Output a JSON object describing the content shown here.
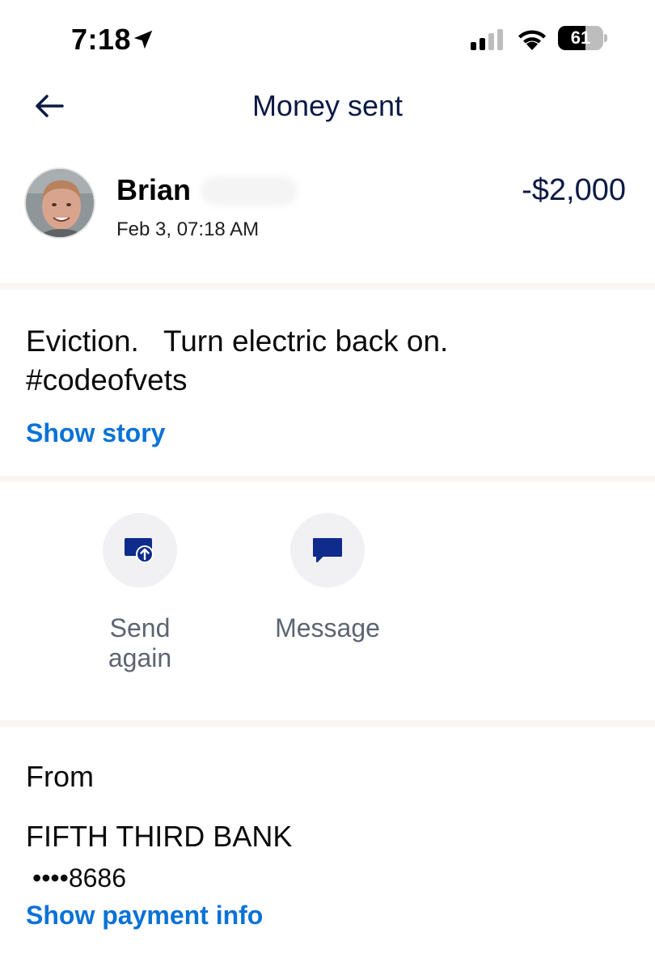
{
  "status_bar": {
    "time": "7:18",
    "battery_level": "61",
    "battery_fraction": 0.61
  },
  "header": {
    "title": "Money sent",
    "back_icon": "arrow-left-icon"
  },
  "transaction": {
    "recipient_name": "Brian",
    "date": "Feb 3, 07:18 AM",
    "amount": "-$2,000"
  },
  "note": {
    "text": "Eviction.   Turn electric back on.\n#codeofvets",
    "show_story_label": "Show story"
  },
  "actions": [
    {
      "label": "Send again",
      "icon": "send-again-icon"
    },
    {
      "label": "Message",
      "icon": "message-icon"
    }
  ],
  "funding": {
    "from_label": "From",
    "bank_name": "FIFTH THIRD BANK",
    "account_masked": "••••8686",
    "show_payment_label": "Show payment info"
  },
  "colors": {
    "link": "#0a72d8",
    "title": "#0c1a46",
    "icon_blue": "#0f2b8c",
    "action_bg": "#f1f1f3",
    "divider": "#f8f5f3"
  }
}
